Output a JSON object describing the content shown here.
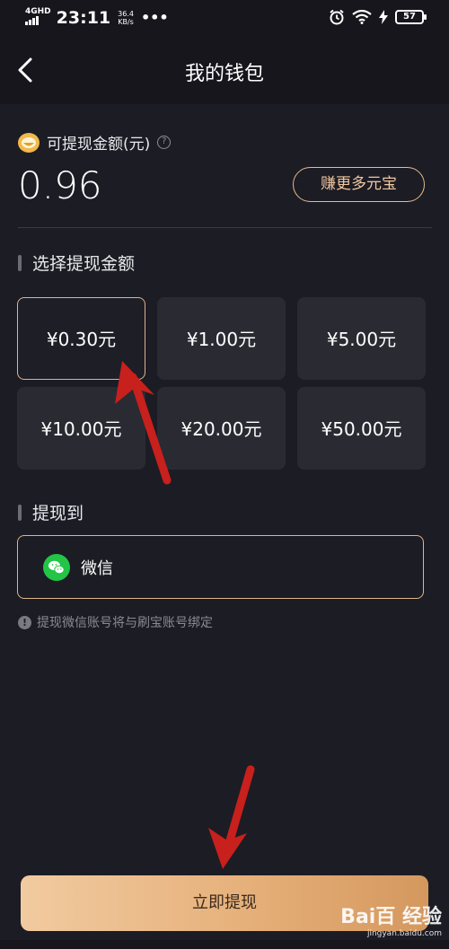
{
  "status_bar": {
    "network": "4GHD",
    "time": "23:11",
    "speed_value": "36.4",
    "speed_unit": "KB/s",
    "more": "•••",
    "battery": "57"
  },
  "nav": {
    "title": "我的钱包",
    "back_icon": "chevron-left-icon"
  },
  "balance": {
    "label": "可提现金额(元)",
    "help": "?",
    "amount": "0.96",
    "earn_button": "赚更多元宝",
    "coin_icon": "coin-icon"
  },
  "amount_section": {
    "title": "选择提现金额",
    "options": [
      {
        "label": "¥0.30元",
        "selected": true
      },
      {
        "label": "¥1.00元",
        "selected": false
      },
      {
        "label": "¥5.00元",
        "selected": false
      },
      {
        "label": "¥10.00元",
        "selected": false
      },
      {
        "label": "¥20.00元",
        "selected": false
      },
      {
        "label": "¥50.00元",
        "selected": false
      }
    ]
  },
  "withdraw_to": {
    "title": "提现到",
    "method": "微信",
    "method_icon": "wechat-icon"
  },
  "note": {
    "icon": "info-icon",
    "text": "提现微信账号将与刷宝账号绑定"
  },
  "submit_button": "立即提现",
  "watermark": {
    "main": "Bai百 经验",
    "sub": "jingyan.baidu.com"
  },
  "colors": {
    "background": "#1c1c24",
    "accent_gold": "#e0b487",
    "tile": "#2a2a33",
    "wechat_green": "#22c546",
    "annotation_red": "#c8201c"
  }
}
